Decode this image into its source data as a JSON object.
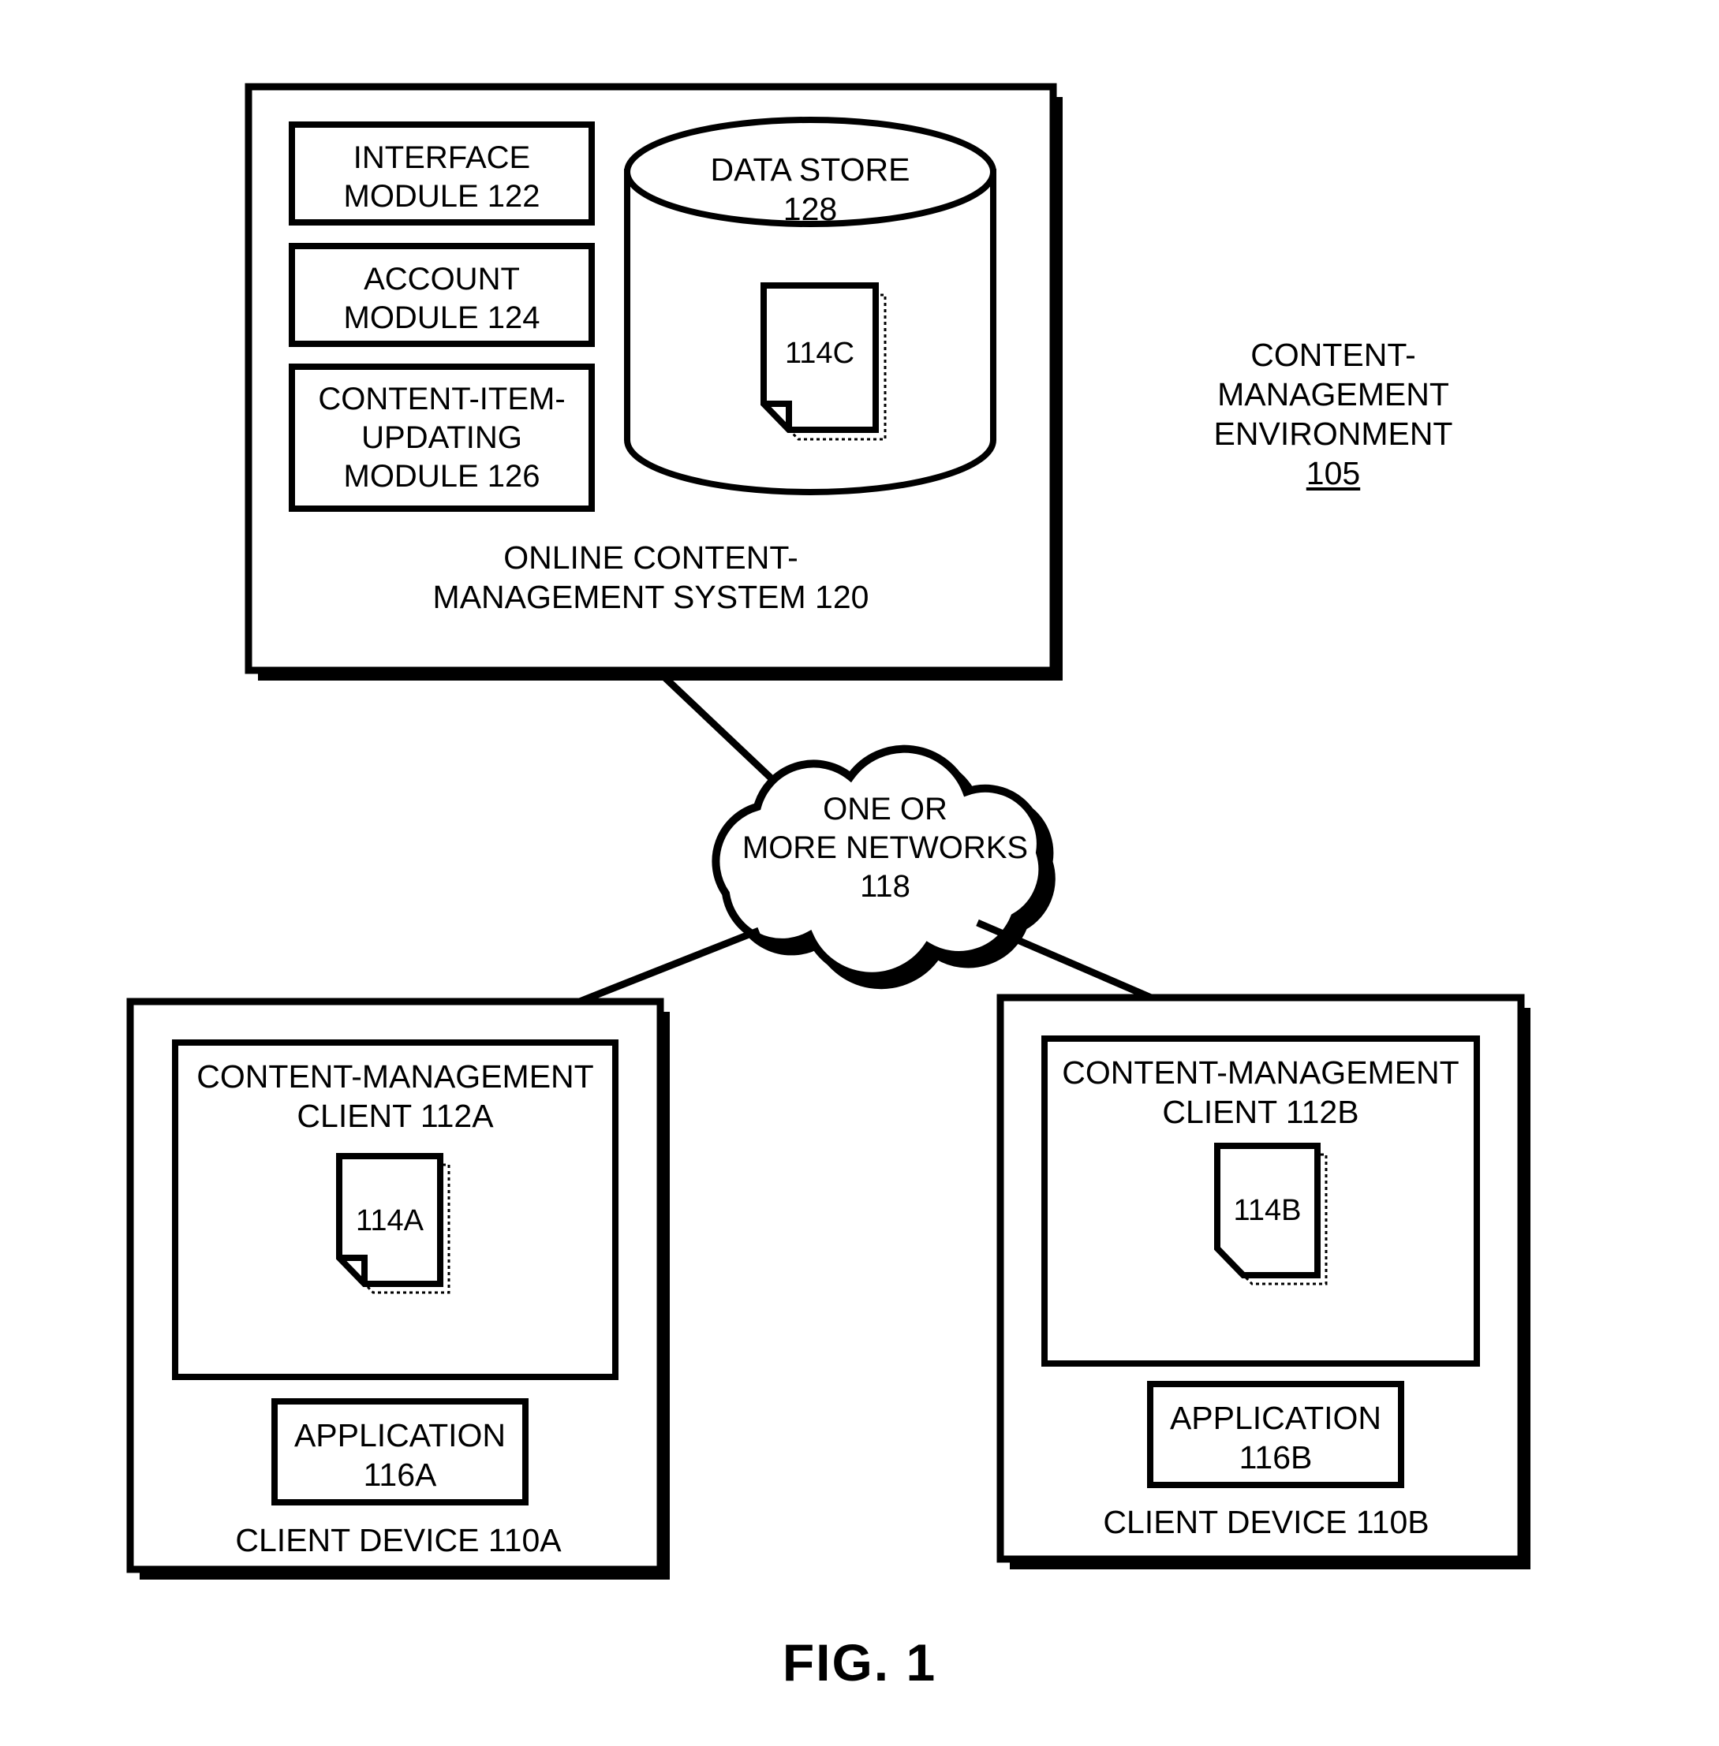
{
  "figure": {
    "caption": "FIG. 1",
    "title": "Content-Management Environment"
  },
  "environment": {
    "label_line1": "CONTENT-",
    "label_line2": "MANAGEMENT",
    "label_line3": "ENVIRONMENT",
    "reference_number": "105"
  },
  "online_system": {
    "label_line1": "ONLINE CONTENT-",
    "label_line2": "MANAGEMENT SYSTEM 120",
    "reference_number": "120",
    "modules": [
      {
        "name": "interface-module",
        "line1": "INTERFACE",
        "line2": "MODULE 122",
        "reference_number": "122"
      },
      {
        "name": "account-module",
        "line1": "ACCOUNT",
        "line2": "MODULE 124",
        "reference_number": "124"
      },
      {
        "name": "content-item-updating-module",
        "line1": "CONTENT-ITEM-",
        "line2": "UPDATING",
        "line3": "MODULE 126",
        "reference_number": "126"
      }
    ],
    "data_store": {
      "label_line1": "DATA STORE",
      "label_line2": "128",
      "reference_number": "128",
      "content_item": "114C"
    }
  },
  "network": {
    "label_line1": "ONE OR",
    "label_line2": "MORE NETWORKS",
    "label_line3": "118",
    "reference_number": "118"
  },
  "client_devices": [
    {
      "name": "client-device-a",
      "device_label": "CLIENT DEVICE 110A",
      "device_reference": "110A",
      "client_line1": "CONTENT-MANAGEMENT",
      "client_line2": "CLIENT 112A",
      "client_reference": "112A",
      "content_item": "114A",
      "application_line1": "APPLICATION",
      "application_line2": "116A",
      "application_reference": "116A"
    },
    {
      "name": "client-device-b",
      "device_label": "CLIENT DEVICE 110B",
      "device_reference": "110B",
      "client_line1": "CONTENT-MANAGEMENT",
      "client_line2": "CLIENT 112B",
      "client_reference": "112B",
      "content_item": "114B",
      "application_line1": "APPLICATION",
      "application_line2": "116B",
      "application_reference": "116B"
    }
  ],
  "colors": {
    "stroke": "#000000",
    "background": "#ffffff"
  }
}
